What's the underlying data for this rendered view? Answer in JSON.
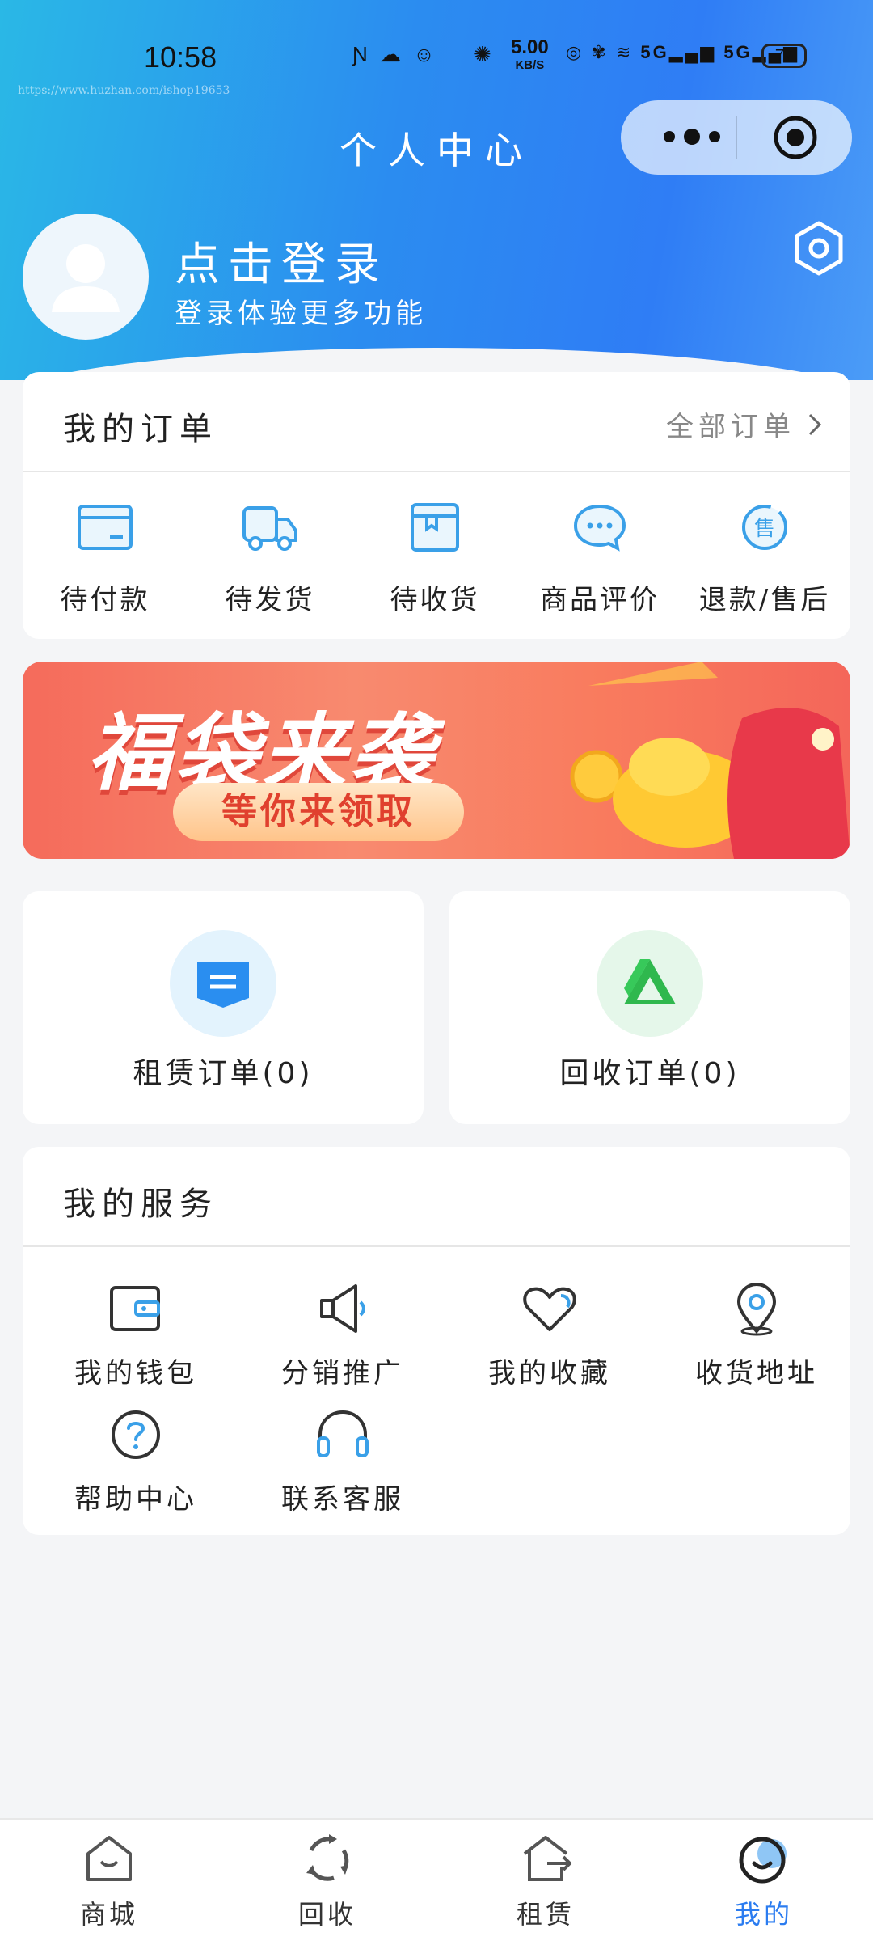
{
  "status_bar": {
    "time": "10:58",
    "speed_value": "5.00",
    "speed_unit": "KB/S",
    "network_1": "5G",
    "network_2": "5G",
    "battery": "77"
  },
  "watermark": "https://www.huzhan.com/ishop19653",
  "nav": {
    "title": "个人中心"
  },
  "profile": {
    "login_title": "点击登录",
    "login_subtitle": "登录体验更多功能"
  },
  "orders": {
    "title": "我的订单",
    "all_label": "全部订单",
    "items": [
      {
        "label": "待付款",
        "icon": "card-icon"
      },
      {
        "label": "待发货",
        "icon": "truck-icon"
      },
      {
        "label": "待收货",
        "icon": "package-icon"
      },
      {
        "label": "商品评价",
        "icon": "comment-icon"
      },
      {
        "label": "退款/售后",
        "icon": "after-sale-icon"
      }
    ]
  },
  "banner": {
    "title": "福袋来袭",
    "button": "等你来领取"
  },
  "rent_order": {
    "label": "租赁订单(0)",
    "icon": "rent-order-icon",
    "color": "#2a8ef0"
  },
  "recycle_order": {
    "label": "回收订单(0)",
    "icon": "recycle-icon",
    "color": "#2fb84e"
  },
  "services": {
    "title": "我的服务",
    "items": [
      {
        "label": "我的钱包",
        "icon": "wallet-icon"
      },
      {
        "label": "分销推广",
        "icon": "megaphone-icon"
      },
      {
        "label": "我的收藏",
        "icon": "heart-icon"
      },
      {
        "label": "收货地址",
        "icon": "location-icon"
      },
      {
        "label": "帮助中心",
        "icon": "help-icon"
      },
      {
        "label": "联系客服",
        "icon": "headset-icon"
      }
    ]
  },
  "tabbar": {
    "items": [
      {
        "label": "商城",
        "icon": "shop-icon"
      },
      {
        "label": "回收",
        "icon": "recycle-tab-icon"
      },
      {
        "label": "租赁",
        "icon": "rent-tab-icon"
      },
      {
        "label": "我的",
        "icon": "profile-tab-icon"
      }
    ],
    "active_index": 3
  },
  "colors": {
    "accent": "#2b7cf0",
    "icon_blue": "#3aa0e8",
    "header_start": "#2ab8e6",
    "header_end": "#4b9cf7"
  }
}
